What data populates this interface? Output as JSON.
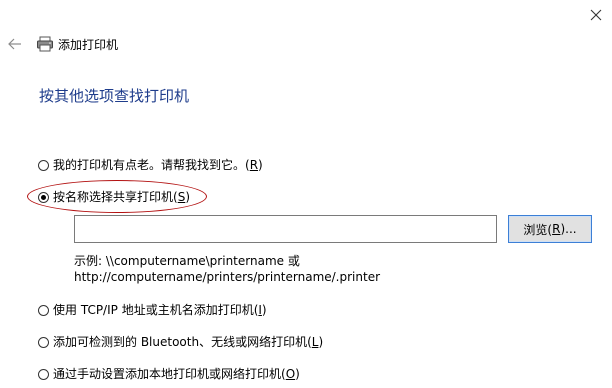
{
  "window": {
    "title": "添加打印机",
    "close_label": "×"
  },
  "page": {
    "heading": "按其他选项查找打印机"
  },
  "options": [
    {
      "label": "我的打印机有点老。请帮我找到它。(",
      "accel": "R",
      "tail": ")",
      "selected": false
    },
    {
      "label": "按名称选择共享打印机(",
      "accel": "S",
      "tail": ")",
      "selected": true
    },
    {
      "label": "使用 TCP/IP 地址或主机名添加打印机(",
      "accel": "I",
      "tail": ")",
      "selected": false
    },
    {
      "label": "添加可检测到的 Bluetooth、无线或网络打印机(",
      "accel": "L",
      "tail": ")",
      "selected": false
    },
    {
      "label": "通过手动设置添加本地打印机或网络打印机(",
      "accel": "O",
      "tail": ")",
      "selected": false
    }
  ],
  "shared_printer": {
    "input_value": "",
    "browse_label_pre": "浏览(",
    "browse_accel": "R",
    "browse_label_post": ")...",
    "example_line1": "示例: \\\\computername\\printername 或",
    "example_line2": "http://computername/printers/printername/.printer"
  },
  "annotation": {
    "ellipse_color": "#b31212"
  },
  "colors": {
    "heading": "#1f3d8c",
    "button_border": "#3c7fd6"
  },
  "icons": {
    "back": "back-arrow-icon",
    "printer": "printer-icon",
    "close": "close-icon"
  }
}
